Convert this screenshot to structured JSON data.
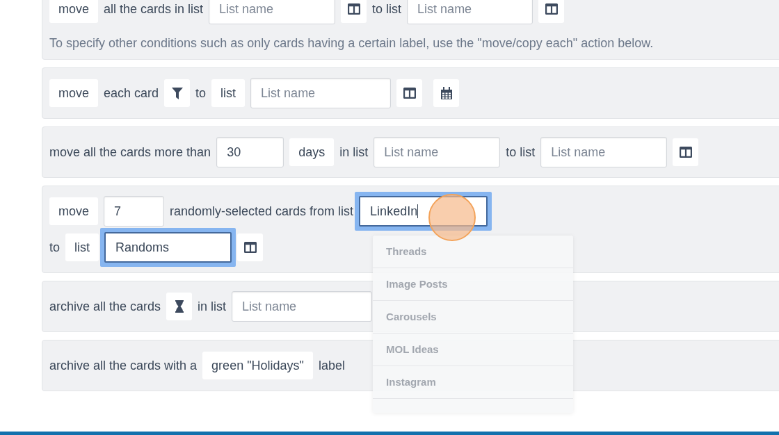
{
  "rules": [
    {
      "lines": [
        {
          "parts": [
            {
              "kind": "chip",
              "label": "move"
            },
            {
              "kind": "text",
              "text": "all the cards in list"
            },
            {
              "kind": "field",
              "placeholder": "List name",
              "focused": false
            },
            {
              "kind": "picker"
            },
            {
              "kind": "text",
              "text": "to list"
            },
            {
              "kind": "field",
              "placeholder": "List name",
              "focused": false
            },
            {
              "kind": "picker"
            }
          ]
        }
      ],
      "note": "To specify other conditions such as only cards having a certain label, use the \"move/copy each\" action below."
    },
    {
      "lines": [
        {
          "parts": [
            {
              "kind": "chip",
              "label": "move"
            },
            {
              "kind": "text",
              "text": "each card"
            },
            {
              "kind": "filter"
            },
            {
              "kind": "text",
              "text": "to"
            },
            {
              "kind": "chip",
              "label": "list"
            },
            {
              "kind": "field",
              "placeholder": "List name",
              "focused": false
            },
            {
              "kind": "picker"
            },
            {
              "kind": "calendar"
            }
          ]
        }
      ]
    },
    {
      "lines": [
        {
          "parts": [
            {
              "kind": "text",
              "text": "move all the cards more than"
            },
            {
              "kind": "field",
              "value": "30",
              "focused": false
            },
            {
              "kind": "chip",
              "label": "days"
            },
            {
              "kind": "text",
              "text": "in list"
            },
            {
              "kind": "field",
              "placeholder": "List name",
              "focused": false
            },
            {
              "kind": "text",
              "text": "to list"
            },
            {
              "kind": "field",
              "placeholder": "List name",
              "focused": false
            },
            {
              "kind": "picker"
            }
          ]
        }
      ]
    },
    {
      "lines": [
        {
          "parts": [
            {
              "kind": "chip",
              "label": "move"
            },
            {
              "kind": "field",
              "value": "7",
              "focused": false
            },
            {
              "kind": "text",
              "text": "randomly-selected cards from list"
            },
            {
              "kind": "field",
              "value": "LinkedIn",
              "focused": true,
              "caret": true,
              "click_marker": true,
              "suggestions": [
                "Threads",
                "Image Posts",
                "Carousels",
                "MOL Ideas",
                "Instagram"
              ]
            }
          ]
        },
        {
          "parts": [
            {
              "kind": "text",
              "text": "to"
            },
            {
              "kind": "chip",
              "label": "list"
            },
            {
              "kind": "field",
              "value": "Randoms",
              "focused": true
            },
            {
              "kind": "picker"
            }
          ]
        }
      ]
    },
    {
      "lines": [
        {
          "parts": [
            {
              "kind": "text",
              "text": "archive all the cards"
            },
            {
              "kind": "timer"
            },
            {
              "kind": "text",
              "text": "in list"
            },
            {
              "kind": "field",
              "placeholder": "List name",
              "focused": false
            }
          ]
        }
      ]
    },
    {
      "lines": [
        {
          "parts": [
            {
              "kind": "text",
              "text": "archive all the cards with a"
            },
            {
              "kind": "chip",
              "label": "green \"Holidays\""
            },
            {
              "kind": "text",
              "text": "label"
            }
          ]
        }
      ]
    }
  ]
}
